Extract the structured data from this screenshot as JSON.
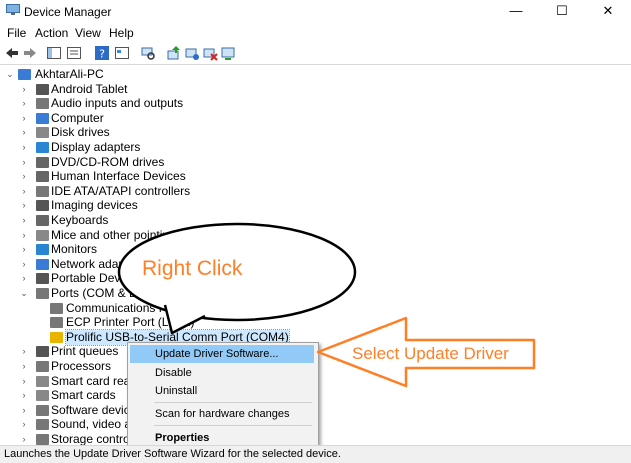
{
  "window": {
    "title": "Device Manager",
    "minimize": "—",
    "maximize": "☐",
    "close": "✕"
  },
  "menu": [
    "File",
    "Action",
    "View",
    "Help"
  ],
  "tree": {
    "root": "AkhtarAli-PC",
    "items": [
      {
        "label": "Android Tablet",
        "icon": "tablet-icon"
      },
      {
        "label": "Audio inputs and outputs",
        "icon": "speaker-icon"
      },
      {
        "label": "Computer",
        "icon": "computer-icon"
      },
      {
        "label": "Disk drives",
        "icon": "disk-icon"
      },
      {
        "label": "Display adapters",
        "icon": "display-icon"
      },
      {
        "label": "DVD/CD-ROM drives",
        "icon": "dvd-icon"
      },
      {
        "label": "Human Interface Devices",
        "icon": "hid-icon"
      },
      {
        "label": "IDE ATA/ATAPI controllers",
        "icon": "ide-icon"
      },
      {
        "label": "Imaging devices",
        "icon": "camera-icon"
      },
      {
        "label": "Keyboards",
        "icon": "keyboard-icon"
      },
      {
        "label": "Mice and other pointing devices",
        "icon": "mouse-icon"
      },
      {
        "label": "Monitors",
        "icon": "monitor-icon"
      },
      {
        "label": "Network adapters",
        "icon": "network-icon"
      },
      {
        "label": "Portable Devices",
        "icon": "portable-icon"
      },
      {
        "label": "Ports (COM & LPT)",
        "icon": "port-icon"
      }
    ],
    "ports_children": [
      "Communications Port (COM1)",
      "ECP Printer Port (LPT1)",
      "Prolific USB-to-Serial Comm Port (COM4)"
    ],
    "items_after": [
      {
        "label": "Print queues",
        "icon": "printer-icon"
      },
      {
        "label": "Processors",
        "icon": "cpu-icon"
      },
      {
        "label": "Smart card readers",
        "icon": "smartcard-icon"
      },
      {
        "label": "Smart cards",
        "icon": "smartcard-icon"
      },
      {
        "label": "Software devices",
        "icon": "software-icon"
      },
      {
        "label": "Sound, video and game controllers",
        "icon": "sound-icon"
      },
      {
        "label": "Storage controllers",
        "icon": "storage-icon"
      }
    ]
  },
  "context_menu": {
    "update": "Update Driver Software...",
    "disable": "Disable",
    "uninstall": "Uninstall",
    "scan": "Scan for hardware changes",
    "properties": "Properties"
  },
  "annotations": {
    "right_click": "Right Click",
    "select_update": "Select Update Driver"
  },
  "status": "Launches the Update Driver Software Wizard for the selected device.",
  "colors": {
    "annotation": "#ff7f27",
    "selection": "#cde8ff",
    "menu_highlight": "#91c9f7"
  }
}
